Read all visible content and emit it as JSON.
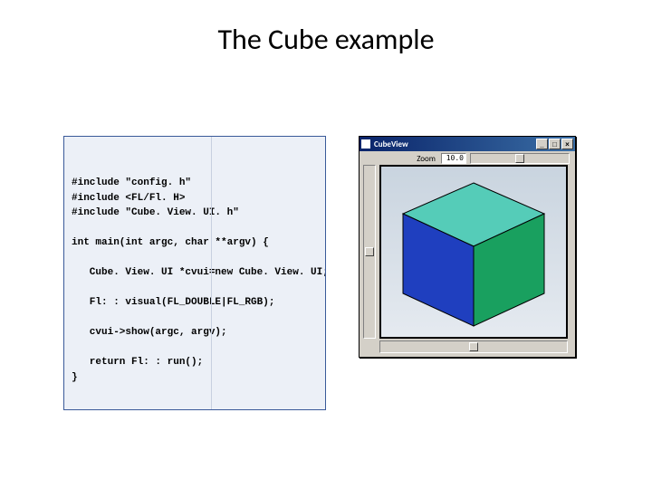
{
  "title": "The Cube example",
  "code": {
    "l1": "#include \"config. h\"",
    "l2": "#include <FL/Fl. H>",
    "l3": "#include \"Cube. View. UI. h\"",
    "l4": "int main(int argc, char **argv) {",
    "l5": "   Cube. View. UI *cvui=new Cube. View. UI;",
    "l6": "   Fl: : visual(FL_DOUBLE|FL_RGB);",
    "l7": "   cvui->show(argc, argv);",
    "l8": "   return Fl: : run();",
    "l9": "}"
  },
  "window": {
    "title": "CubeView",
    "zoom_label": "Zoom",
    "zoom_value": "10.0",
    "buttons": {
      "min": "_",
      "max": "□",
      "close": "×"
    }
  },
  "cube_colors": {
    "top": "#55ccb8",
    "left": "#1f3fbf",
    "right": "#19a05f",
    "edge": "#000000"
  }
}
